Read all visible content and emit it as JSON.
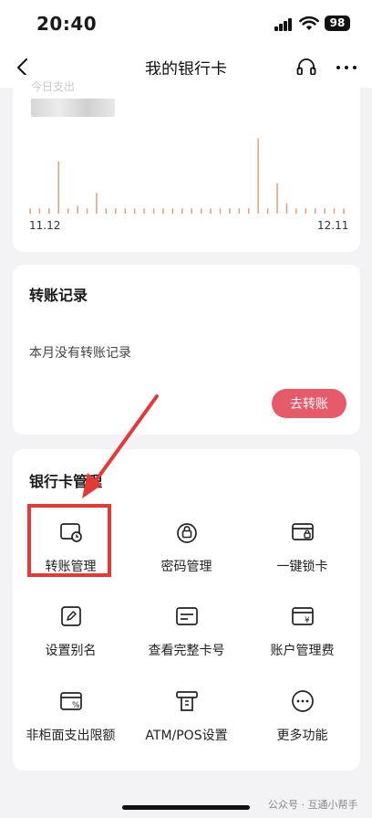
{
  "status_bar": {
    "time": "20:40",
    "battery": "98"
  },
  "nav": {
    "title": "我的银行卡"
  },
  "chart_card": {
    "caption": "今日支出",
    "chart_data": {
      "type": "bar",
      "x_start_label": "11.12",
      "x_end_label": "12.11",
      "values": [
        0.1,
        0.1,
        0.1,
        1,
        0.1,
        0.15,
        0.1,
        0.4,
        0.1,
        0.1,
        0.1,
        0.1,
        0.1,
        0.1,
        0.1,
        0.1,
        0.1,
        0.1,
        0.1,
        0.1,
        0.1,
        0.1,
        0.1,
        0.1,
        1.45,
        0.1,
        0.58,
        0.2,
        0.1,
        0.1,
        0.1,
        0.1,
        0.1,
        0.1
      ],
      "bar_color": "#e0a07a",
      "grid": false
    }
  },
  "transfer_card": {
    "title": "转账记录",
    "empty_text": "本月没有转账记录",
    "button_label": "去转账",
    "button_color": "#e65a69"
  },
  "manage_card": {
    "title": "银行卡管理",
    "items": [
      {
        "label": "转账管理",
        "icon": "card-clock-icon"
      },
      {
        "label": "密码管理",
        "icon": "lock-icon"
      },
      {
        "label": "一键锁卡",
        "icon": "card-lock-icon"
      },
      {
        "label": "设置别名",
        "icon": "edit-icon"
      },
      {
        "label": "查看完整卡号",
        "icon": "card-number-icon"
      },
      {
        "label": "账户管理费",
        "icon": "card-yen-icon"
      },
      {
        "label": "非柜面支出限额",
        "icon": "card-percent-icon"
      },
      {
        "label": "ATM/POS设置",
        "icon": "atm-icon"
      },
      {
        "label": "更多功能",
        "icon": "more-icon"
      }
    ]
  },
  "annotation": {
    "highlight_color": "#e53935"
  },
  "watermark": "公众号 · 互通小帮手"
}
